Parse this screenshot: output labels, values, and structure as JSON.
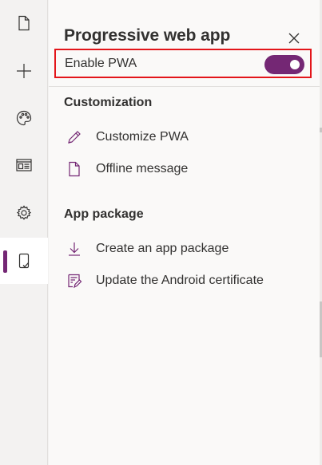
{
  "panel": {
    "title": "Progressive web app",
    "enable_pwa": {
      "label": "Enable PWA",
      "state": "on"
    }
  },
  "sections": [
    {
      "heading": "Customization",
      "items": [
        {
          "label": "Customize PWA",
          "icon": "pencil-icon"
        },
        {
          "label": "Offline message",
          "icon": "document-icon"
        }
      ]
    },
    {
      "heading": "App package",
      "items": [
        {
          "label": "Create an app package",
          "icon": "download-icon"
        },
        {
          "label": "Update the Android certificate",
          "icon": "certificate-icon"
        }
      ]
    }
  ],
  "rail": {
    "items": [
      {
        "name": "pages",
        "icon": "page-icon"
      },
      {
        "name": "add",
        "icon": "plus-icon"
      },
      {
        "name": "themes",
        "icon": "palette-icon"
      },
      {
        "name": "components",
        "icon": "layout-icon"
      },
      {
        "name": "settings",
        "icon": "gear-icon"
      },
      {
        "name": "mobile",
        "icon": "mobile-icon",
        "active": true
      }
    ]
  },
  "colors": {
    "accent": "#742774",
    "highlight_border": "#e3151a",
    "panel_bg": "#faf9f8",
    "rail_bg": "#f3f2f1"
  }
}
